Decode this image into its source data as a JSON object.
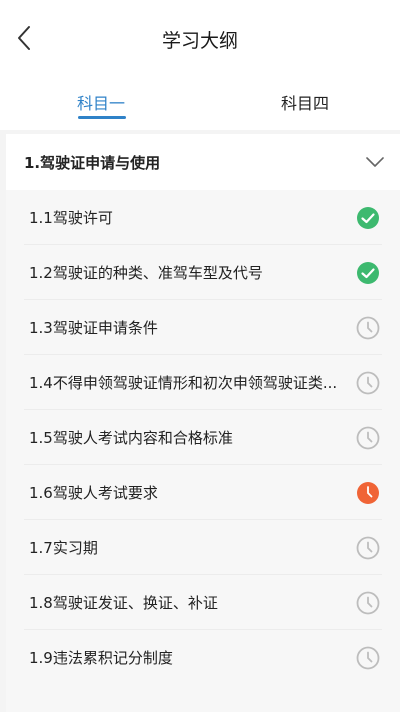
{
  "header": {
    "title": "学习大纲",
    "back_icon": "chevron-left-icon"
  },
  "tabs": [
    {
      "label": "科目一",
      "active": true
    },
    {
      "label": "科目四",
      "active": false
    }
  ],
  "colors": {
    "accent": "#2f82c8",
    "done": "#3db96f",
    "current": "#f06436",
    "pending": "#bdbdbd"
  },
  "section": {
    "title": "1.驾驶证申请与使用",
    "expand_icon": "chevron-down-icon"
  },
  "items": [
    {
      "label": "1.1驾驶许可",
      "status": "done",
      "icon": "check-circle-icon"
    },
    {
      "label": "1.2驾驶证的种类、准驾车型及代号",
      "status": "done",
      "icon": "check-circle-icon"
    },
    {
      "label": "1.3驾驶证申请条件",
      "status": "pending",
      "icon": "clock-icon"
    },
    {
      "label": "1.4不得申领驾驶证情形和初次申领驾驶证类...",
      "status": "pending",
      "icon": "clock-icon"
    },
    {
      "label": "1.5驾驶人考试内容和合格标准",
      "status": "pending",
      "icon": "clock-icon"
    },
    {
      "label": "1.6驾驶人考试要求",
      "status": "current",
      "icon": "clock-icon"
    },
    {
      "label": "1.7实习期",
      "status": "pending",
      "icon": "clock-icon"
    },
    {
      "label": "1.8驾驶证发证、换证、补证",
      "status": "pending",
      "icon": "clock-icon"
    },
    {
      "label": "1.9违法累积记分制度",
      "status": "pending",
      "icon": "clock-icon"
    }
  ]
}
